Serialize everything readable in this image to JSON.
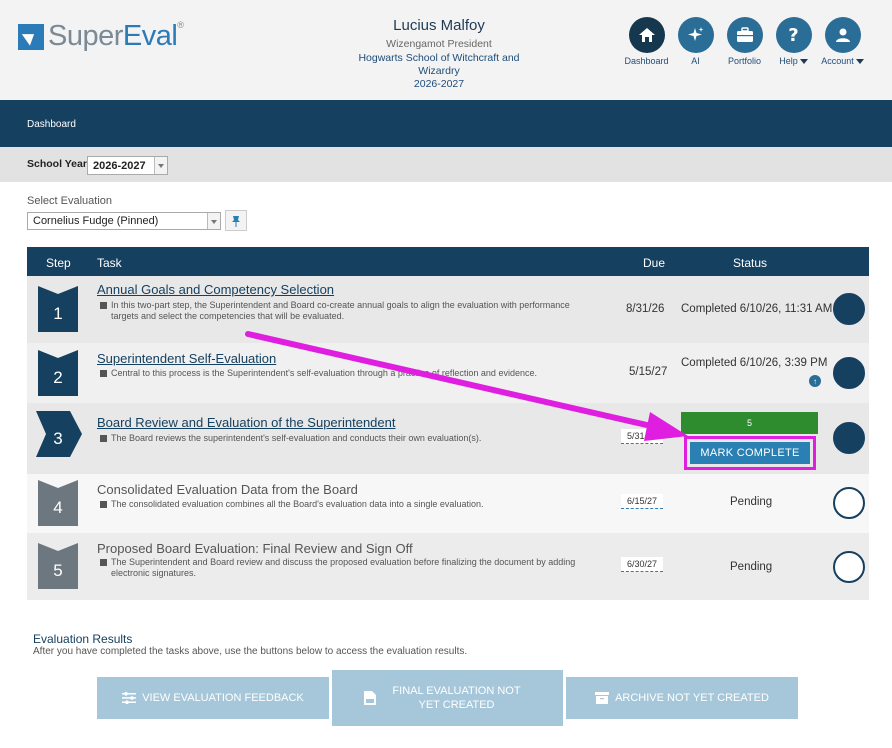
{
  "header": {
    "logo": {
      "part1": "Super",
      "part2": "Eval",
      "mark": "®"
    },
    "user": {
      "name": "Lucius Malfoy",
      "role": "Wizengamot President",
      "school": "Hogwarts School of Witchcraft and Wizardry",
      "year": "2026-2027"
    },
    "nav": [
      {
        "label": "Dashboard",
        "icon": "home-icon",
        "active": true
      },
      {
        "label": "AI",
        "icon": "sparkle-icon",
        "active": false
      },
      {
        "label": "Portfolio",
        "icon": "briefcase-icon",
        "active": false
      },
      {
        "label": "Help",
        "icon": "question-icon",
        "active": false,
        "dropdown": true
      },
      {
        "label": "Account",
        "icon": "user-icon",
        "active": false,
        "dropdown": true
      }
    ]
  },
  "breadcrumb": "Dashboard",
  "school_year": {
    "label": "School Year:",
    "value": "2026-2027"
  },
  "select_evaluation": {
    "label": "Select Evaluation",
    "value": "Cornelius Fudge (Pinned)",
    "pin_icon": "pin-icon"
  },
  "table": {
    "headers": {
      "step": "Step",
      "task": "Task",
      "due": "Due",
      "status": "Status"
    },
    "rows": [
      {
        "step": "1",
        "title": "Annual Goals and Competency Selection",
        "desc": "In this two-part step, the Superintendent and Board co-create annual goals to align the evaluation with performance targets and select the competencies that will be evaluated.",
        "due": "8/31/26",
        "status": "Completed 6/10/26, 11:31 AM"
      },
      {
        "step": "2",
        "title": "Superintendent Self-Evaluation",
        "desc": "Central to this process is the Superintendent's self-evaluation through a practice of reflection and evidence.",
        "due": "5/15/27",
        "status": "Completed 6/10/26, 3:39 PM"
      },
      {
        "step": "3",
        "title": "Board Review and Evaluation of the Superintendent",
        "desc": "The Board reviews the superintendent's self-evaluation and conducts their own evaluation(s).",
        "due": "5/31/27",
        "progress": "5",
        "action": "MARK COMPLETE"
      },
      {
        "step": "4",
        "title": "Consolidated Evaluation Data from the Board",
        "desc": "The consolidated evaluation combines all the Board's evaluation data into a single evaluation.",
        "due": "6/15/27",
        "status": "Pending"
      },
      {
        "step": "5",
        "title": "Proposed Board Evaluation: Final Review and Sign Off",
        "desc": "The Superintendent and Board review and discuss the proposed evaluation before finalizing the document by adding electronic signatures.",
        "due": "6/30/27",
        "status": "Pending"
      }
    ]
  },
  "results": {
    "title": "Evaluation Results",
    "desc": "After you have completed the tasks above, use the buttons below to access the evaluation results.",
    "buttons": [
      {
        "label": "VIEW EVALUATION FEEDBACK",
        "icon": "sliders-icon"
      },
      {
        "label": "FINAL EVALUATION NOT YET CREATED",
        "icon": "pdf-icon"
      },
      {
        "label": "ARCHIVE NOT YET CREATED",
        "icon": "archive-icon"
      }
    ]
  },
  "colors": {
    "navy": "#16405f",
    "accent": "#2a7fb3",
    "green": "#2e8b2e",
    "highlight": "#e01ee0"
  }
}
